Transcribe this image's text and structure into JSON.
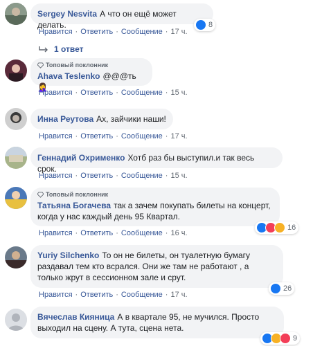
{
  "actions": {
    "like": "Нравится",
    "reply": "Ответить",
    "message": "Сообщение"
  },
  "badge_label": "Топовый поклонник",
  "comments": [
    {
      "author": "Sergey Nesvita",
      "text": "А что он ещё может делать.",
      "time": "17 ч.",
      "reactions": "8",
      "replies": "1 ответ"
    },
    {
      "author": "Ahava Teslenko",
      "text": "@@@ть 🤦‍♀️",
      "time": "15 ч."
    },
    {
      "author": "Инна Реутова",
      "text": "Ах, зайчики наши!",
      "time": "17 ч."
    },
    {
      "author": "Геннадий Охрименко",
      "text": "Хотб раз бы выступил.и так весь срок.",
      "time": "15 ч."
    },
    {
      "author": "Татьяна Богачева",
      "text": "так а зачем покупать билеты на концерт, когда у нас каждый день 95 Квартал.",
      "time": "16 ч.",
      "reactions": "16"
    },
    {
      "author": "Yuriy Silchenko",
      "text": "То он не билеты, он туалетную бумагу раздавал тем кто всрался. Они же там не работают , а только жрут в сессионном зале и срут.",
      "time": "17 ч.",
      "reactions": "26"
    },
    {
      "author": "Вячеслав Кияница",
      "text": "А в квартале 95, не мучился. Просто выходил на сцену. А тута, сцена нета.",
      "reactions": "9"
    }
  ],
  "colors": {
    "link": "#385898",
    "bubble": "#f2f3f5",
    "meta": "#606770",
    "like": "#1877f2",
    "heart": "#f33e58",
    "haha": "#f7b125"
  }
}
